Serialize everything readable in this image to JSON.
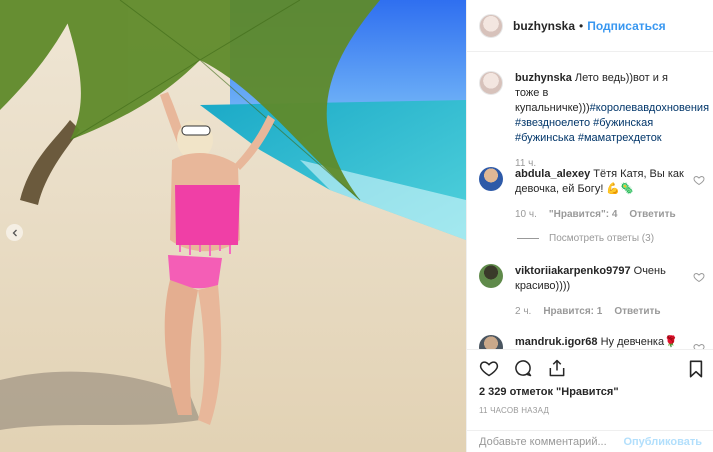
{
  "header": {
    "username": "buzhynska",
    "separator": "•",
    "follow_label": "Подписаться"
  },
  "caption": {
    "username": "buzhynska",
    "text": "Лето ведь))вот и я тоже в купальничке)))",
    "hashtags": "#королевавдохновения #звездноелето #бужинская #бужинська #маматрехдеток",
    "time": "11 ч."
  },
  "comments": [
    {
      "username": "abdula_alexey",
      "text": "Тётя Катя, Вы как девочка, ей Богу! 💪🦠",
      "time": "10 ч.",
      "likes": "\"Нравится\": 4",
      "reply": "Ответить"
    },
    {
      "username": "viktoriiakarpenko9797",
      "text": "Очень красиво))))",
      "time": "2 ч.",
      "likes": "Нравится: 1",
      "reply": "Ответить"
    },
    {
      "username": "mandruk.igor68",
      "text": "Ну девченка🌹"
    }
  ],
  "view_replies": "Посмотреть ответы (3)",
  "icons": {
    "like": "heart-icon",
    "comment": "comment-icon",
    "share": "share-icon",
    "save": "bookmark-icon",
    "prev": "chevron-left-icon"
  },
  "likes_text": "2 329 отметок \"Нравится\"",
  "time_ago": "11 ЧАСОВ НАЗАД",
  "add_comment": {
    "placeholder": "Добавьте комментарий...",
    "publish_label": "Опубликовать"
  },
  "colors": {
    "link": "#3897f0",
    "hashtag": "#003569",
    "muted": "#999999",
    "publish_disabled": "#b2dffc"
  }
}
